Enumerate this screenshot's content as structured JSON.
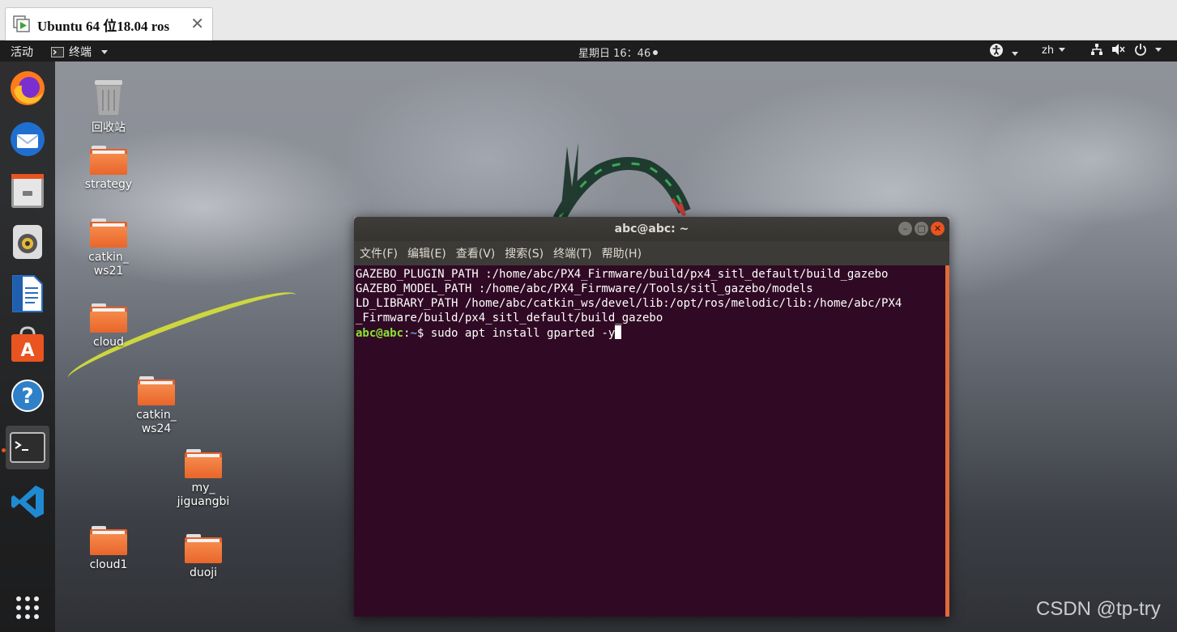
{
  "host": {
    "tab_title": "Ubuntu 64 位18.04 ros",
    "close_glyph": "✕"
  },
  "topbar": {
    "activities": "活动",
    "app_menu": "终端",
    "clock": "星期日 16：46",
    "language": "zh"
  },
  "dock": {
    "items": [
      "firefox",
      "thunderbird",
      "files",
      "rhythmbox",
      "libreoffice-writer",
      "ubuntu-software",
      "help",
      "terminal",
      "vscode",
      "show-applications"
    ]
  },
  "desktop_icons": [
    {
      "label": "回收站",
      "type": "trash"
    },
    {
      "label": "strategy",
      "type": "folder"
    },
    {
      "label": "catkin_ ws21",
      "type": "folder"
    },
    {
      "label": "cloud",
      "type": "folder"
    },
    {
      "label": "catkin_ ws24",
      "type": "folder"
    },
    {
      "label": "my_ jiguangbi",
      "type": "folder"
    },
    {
      "label": "cloud1",
      "type": "folder"
    },
    {
      "label": "duoji",
      "type": "folder"
    }
  ],
  "terminal": {
    "title": "abc@abc: ~",
    "menu": [
      "文件(F)",
      "编辑(E)",
      "查看(V)",
      "搜索(S)",
      "终端(T)",
      "帮助(H)"
    ],
    "lines": [
      "GAZEBO_PLUGIN_PATH :/home/abc/PX4_Firmware/build/px4_sitl_default/build_gazebo",
      "GAZEBO_MODEL_PATH :/home/abc/PX4_Firmware//Tools/sitl_gazebo/models",
      "LD_LIBRARY_PATH /home/abc/catkin_ws/devel/lib:/opt/ros/melodic/lib:/home/abc/PX4",
      "_Firmware/build/px4_sitl_default/build_gazebo"
    ],
    "prompt_user": "abc@abc",
    "prompt_sep": ":",
    "prompt_path": "~",
    "prompt_symbol": "$ ",
    "command": "sudo apt install gparted -y"
  },
  "watermark": "CSDN @tp-try",
  "colors": {
    "terminal_bg": "#300a24",
    "accent": "#e95420",
    "prompt_user": "#8ae234",
    "prompt_path": "#729fcf"
  }
}
